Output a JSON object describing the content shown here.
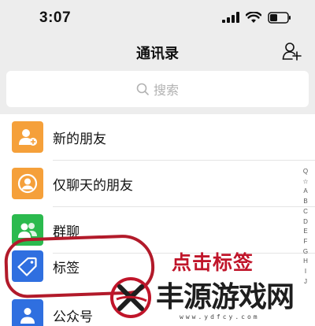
{
  "status_bar": {
    "time": "3:07",
    "icons": [
      "signal-icon",
      "wifi-icon",
      "battery-icon"
    ]
  },
  "nav": {
    "title": "通讯录",
    "action_icon": "add-friend-icon"
  },
  "search": {
    "placeholder": "搜索",
    "icon": "search-icon"
  },
  "contacts_menu": {
    "items": [
      {
        "label": "新的朋友",
        "icon": "new-friend-icon",
        "color": "#f5a03a"
      },
      {
        "label": "仅聊天的朋友",
        "icon": "chat-only-friend-icon",
        "color": "#f5a03a"
      },
      {
        "label": "群聊",
        "icon": "group-chat-icon",
        "color": "#2bba4e"
      },
      {
        "label": "标签",
        "icon": "tag-icon",
        "color": "#2f6fe0"
      },
      {
        "label": "公众号",
        "icon": "official-account-icon",
        "color": "#2f6fe0"
      }
    ]
  },
  "index_bar": {
    "letters": [
      "Q",
      "☆",
      "A",
      "B",
      "C",
      "D",
      "E",
      "F",
      "G",
      "H",
      "I",
      "J"
    ]
  },
  "annotation": {
    "text": "点击标签",
    "color": "#c0152a"
  },
  "watermark": {
    "text": "丰源游戏网",
    "url": "www.ydfcy.com"
  }
}
